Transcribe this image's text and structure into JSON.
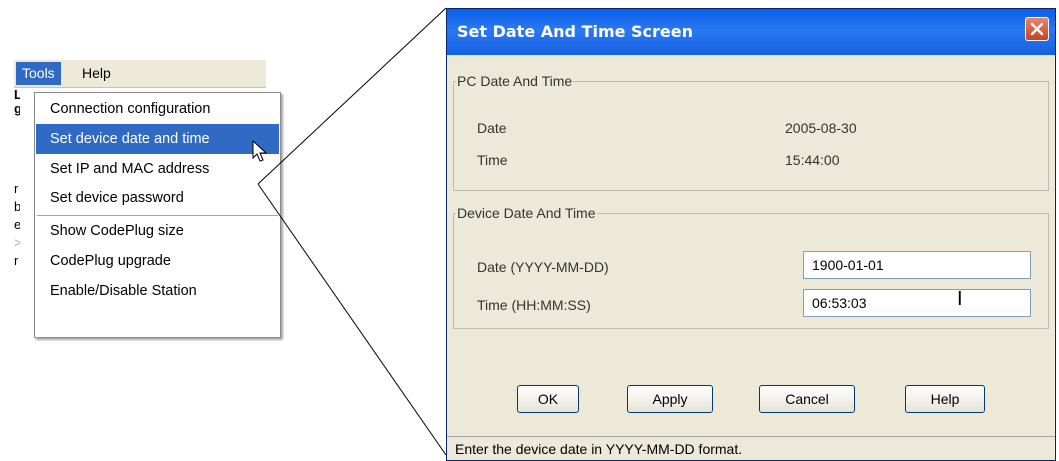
{
  "menubar": {
    "tools_label": "Tools",
    "help_label": "Help"
  },
  "page_fragments": [
    "r",
    "b",
    "e",
    ">",
    "r"
  ],
  "tools_menu": {
    "items": [
      {
        "label": "Connection configuration"
      },
      {
        "label": "Set device date and time",
        "hovered": true
      },
      {
        "label": "Set IP and MAC address"
      },
      {
        "label": "Set device password"
      },
      {
        "label": "Show CodePlug size"
      },
      {
        "label": "CodePlug upgrade"
      },
      {
        "label": "Enable/Disable Station"
      }
    ]
  },
  "dialog": {
    "title": "Set Date And Time Screen",
    "pc_group": {
      "legend": "PC Date And Time",
      "date_label": "Date",
      "date_value": "2005-08-30",
      "time_label": "Time",
      "time_value": "15:44:00"
    },
    "device_group": {
      "legend": "Device Date And Time",
      "date_label": "Date (YYYY-MM-DD)",
      "date_value": "1900-01-01",
      "time_label": "Time (HH:MM:SS)",
      "time_value": "06:53:03"
    },
    "buttons": {
      "ok": "OK",
      "apply": "Apply",
      "cancel": "Cancel",
      "help": "Help"
    },
    "status": "Enter the device date in YYYY-MM-DD format."
  },
  "colors": {
    "title_bar": "#0a5fe8",
    "menu_highlight": "#316ac5",
    "dialog_face": "#ece9d8"
  }
}
